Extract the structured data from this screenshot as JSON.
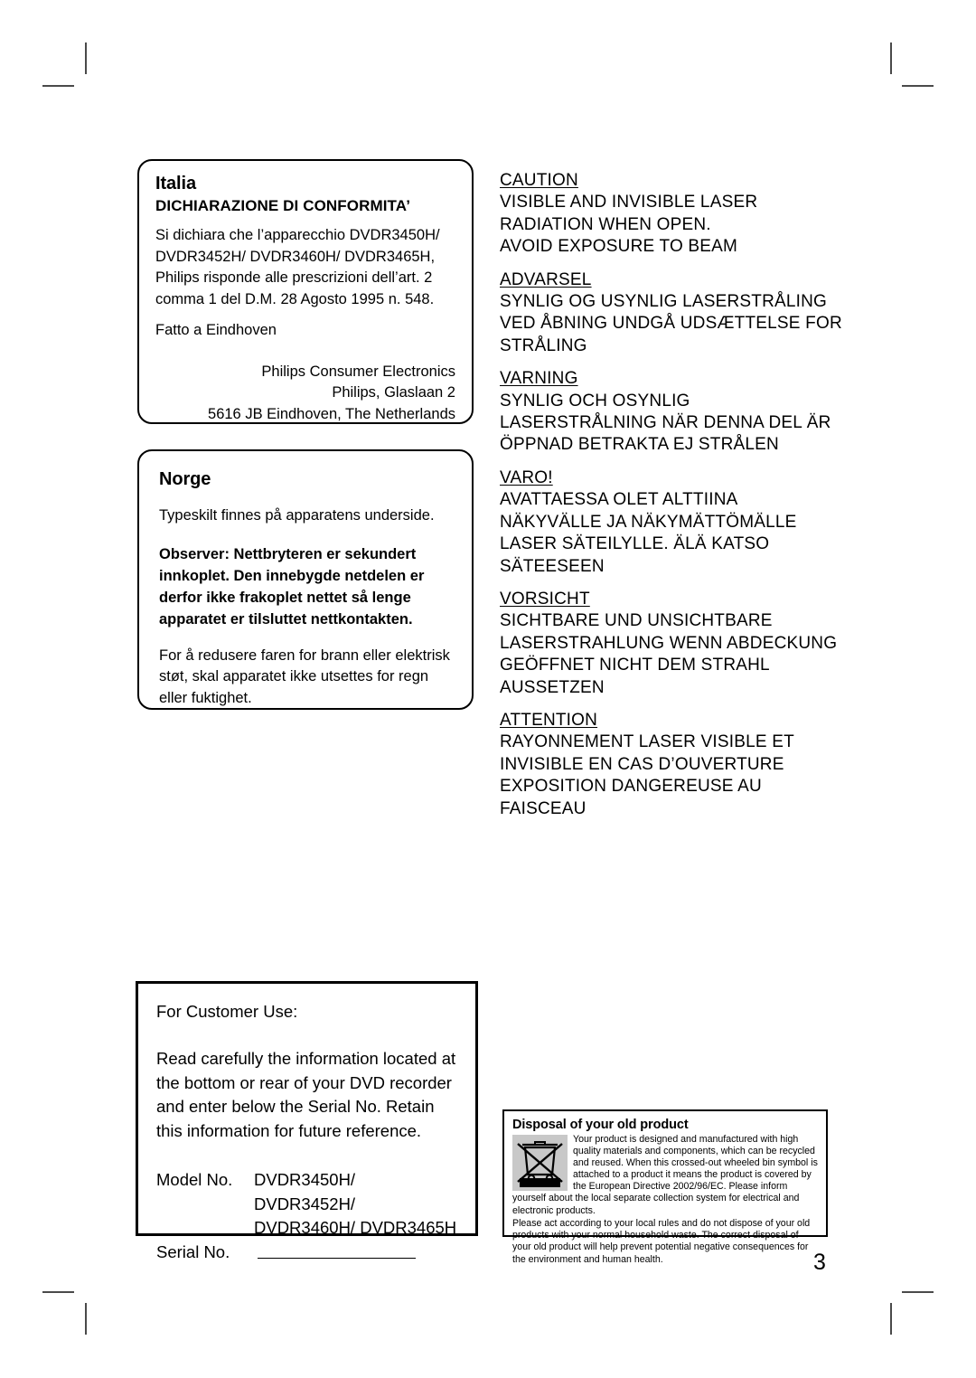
{
  "page": {
    "number": "3"
  },
  "italia": {
    "title": "Italia",
    "subtitle": "DICHIARAZIONE DI CONFORMITA’",
    "paragraph": "Si dichiara che l’apparecchio DVDR3450H/ DVDR3452H/ DVDR3460H/ DVDR3465H, Philips risponde alle prescrizioni dell’art. 2 comma 1 del D.M. 28 Agosto 1995 n. 548.",
    "place": "Fatto a Eindhoven",
    "address": [
      "Philips Consumer Electronics",
      "Philips, Glaslaan 2",
      "5616 JB Eindhoven, The Netherlands"
    ]
  },
  "norge": {
    "title": "Norge",
    "line1": "Typeskilt finnes på apparatens underside.",
    "bold_note": "Observer: Nettbryteren er sekundert innkoplet. Den innebygde netdelen er derfor ikke frakoplet nettet så lenge apparatet er tilsluttet nettkontakten.",
    "paragraph": "For å redusere faren for brann eller elektrisk støt, skal apparatet ikke utsettes for regn eller fuktighet."
  },
  "laser_warnings": [
    {
      "heading": "CAUTION",
      "lines": [
        "VISIBLE AND INVISIBLE LASER",
        "RADIATION WHEN OPEN.",
        "AVOID EXPOSURE TO BEAM"
      ]
    },
    {
      "heading": "ADVARSEL",
      "lines": [
        "SYNLIG OG USYNLIG LASERSTRÅLING",
        "VED ÅBNING UNDGÅ UDSÆTTELSE FOR",
        "STRÅLING"
      ]
    },
    {
      "heading": "VARNING",
      "lines": [
        "SYNLIG OCH OSYNLIG",
        "LASERSTRÅLNING NÄR DENNA DEL ÄR",
        "ÖPPNAD BETRAKTA EJ STRÅLEN"
      ]
    },
    {
      "heading": "VARO!",
      "lines": [
        "AVATTAESSA OLET ALTTIINA",
        "NÄKYVÄLLE JA NÄKYMÄTTÖMÄLLE",
        "LASER SÄTEILYLLE. ÄLÄ KATSO",
        "SÄTEESEEN"
      ]
    },
    {
      "heading": "VORSICHT",
      "lines": [
        "SICHTBARE UND UNSICHTBARE",
        "LASERSTRAHLUNG WENN ABDECKUNG",
        "GEÖFFNET NICHT DEM STRAHL",
        "AUSSETZEN"
      ]
    },
    {
      "heading": "ATTENTION",
      "lines": [
        "RAYONNEMENT LASER VISIBLE ET",
        "INVISIBLE EN CAS D’OUVERTURE",
        "EXPOSITION DANGEREUSE AU",
        "FAISCEAU"
      ]
    }
  ],
  "customer_use": {
    "lead": "For Customer Use:",
    "paragraph": "Read carefully the information located at the bottom or rear of your DVD recorder and enter below the Serial No. Retain this information for future reference.",
    "model_label": "Model No.",
    "model_value_line1": "DVDR3450H/ DVDR3452H/",
    "model_value_line2": "DVDR3460H/ DVDR3465H",
    "serial_label": "Serial No.",
    "serial_value": ""
  },
  "disposal": {
    "title": "Disposal of your old product",
    "icon": "crossed-out-wheeled-bin-icon",
    "paragraph_top": "Your product is designed and manufactured with high quality materials and components, which can be recycled and reused. When this crossed-out wheeled bin symbol is attached to a product it means the product is covered by the European Directive 2002/96/EC. Please inform yourself about the local separate collection system for electrical and electronic products.",
    "paragraph_bottom": "Please act according to your local rules and do not dispose of your old products with your normal household waste. The correct disposal of your old product will help prevent potential negative consequences for the environment and human health."
  },
  "colors": {
    "text": "#000000",
    "crop_mark": "#4a4a4a",
    "weee_background": "#c8c8c8",
    "page_background": "#ffffff"
  }
}
